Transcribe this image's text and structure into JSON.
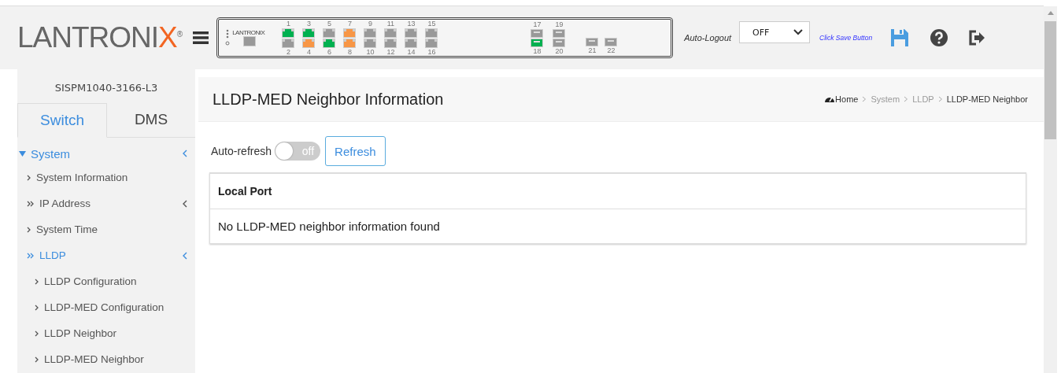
{
  "header": {
    "logo": "LANTRONIX",
    "logo_mark": "®",
    "panel_logo": "LANTRONIX",
    "ports": [
      {
        "top": {
          "label": "1",
          "color": "#00b050"
        },
        "bottom": {
          "label": "2",
          "color": "#999999"
        }
      },
      {
        "top": {
          "label": "3",
          "color": "#00b050"
        },
        "bottom": {
          "label": "4",
          "color": "#f79646"
        }
      },
      {
        "top": {
          "label": "5",
          "color": "#999999"
        },
        "bottom": {
          "label": "6",
          "color": "#00b050"
        }
      },
      {
        "top": {
          "label": "7",
          "color": "#f79646"
        },
        "bottom": {
          "label": "8",
          "color": "#f79646"
        }
      },
      {
        "top": {
          "label": "9",
          "color": "#999999"
        },
        "bottom": {
          "label": "10",
          "color": "#999999"
        }
      },
      {
        "top": {
          "label": "11",
          "color": "#999999"
        },
        "bottom": {
          "label": "12",
          "color": "#999999"
        }
      },
      {
        "top": {
          "label": "13",
          "color": "#999999"
        },
        "bottom": {
          "label": "14",
          "color": "#999999"
        }
      },
      {
        "top": {
          "label": "15",
          "color": "#999999"
        },
        "bottom": {
          "label": "16",
          "color": "#999999"
        }
      }
    ],
    "sfp_ports": [
      {
        "top": {
          "label": "17",
          "color": "#999999"
        },
        "bottom": {
          "label": "18",
          "color": "#00b050"
        }
      },
      {
        "top": {
          "label": "19",
          "color": "#999999"
        },
        "bottom": {
          "label": "20",
          "color": "#999999"
        }
      }
    ],
    "extra_ports": [
      {
        "label": "21",
        "color": "#999999"
      },
      {
        "label": "22",
        "color": "#999999"
      }
    ],
    "auto_logout_label": "Auto-Logout",
    "auto_logout_value": "OFF",
    "save_hint": "Click Save Button"
  },
  "sidebar": {
    "device": "SISPM1040-3166-L3",
    "tabs": [
      {
        "label": "Switch",
        "selected": true
      },
      {
        "label": "DMS",
        "selected": false
      }
    ],
    "menu": [
      {
        "label": "System",
        "expanded": true,
        "selected": true,
        "children": [
          {
            "label": "System Information",
            "expanded": false,
            "selected": false,
            "has_children": false
          },
          {
            "label": "IP Address",
            "expanded": false,
            "selected": false,
            "has_children": true
          },
          {
            "label": "System Time",
            "expanded": false,
            "selected": false,
            "has_children": false
          },
          {
            "label": "LLDP",
            "expanded": true,
            "selected": true,
            "has_children": true,
            "children": [
              {
                "label": "LLDP Configuration",
                "selected": false
              },
              {
                "label": "LLDP-MED Configuration",
                "selected": false
              },
              {
                "label": "LLDP Neighbor",
                "selected": false
              },
              {
                "label": "LLDP-MED Neighbor",
                "selected": false
              }
            ]
          }
        ]
      }
    ]
  },
  "page": {
    "title": "LLDP-MED Neighbor Information",
    "breadcrumb": [
      "Home",
      "System",
      "LLDP",
      "LLDP-MED Neighbor"
    ],
    "auto_refresh": {
      "label": "Auto-refresh",
      "on": false,
      "state_text": "off"
    },
    "refresh_button": "Refresh",
    "table": {
      "columns": [
        "Local Port"
      ],
      "empty_message": "No LLDP-MED neighbor information found"
    }
  }
}
